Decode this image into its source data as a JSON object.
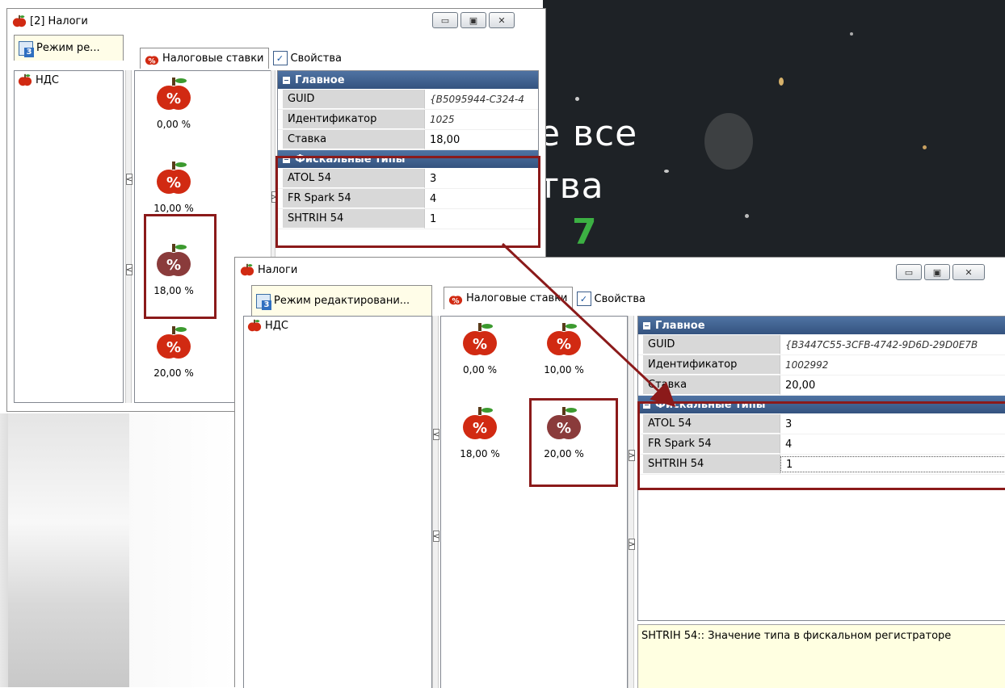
{
  "background": {
    "text_line1": "е все",
    "text_line2": "тва",
    "text_digit": "7"
  },
  "back_window": {
    "title": "[2] Налоги",
    "win_buttons": [
      "▭",
      "▣",
      "✕"
    ],
    "mode_tab_label": "Режим ре...",
    "mode_tab_badge": "3",
    "tab_rates_label": "Налоговые ставки",
    "tab_props_label": "Свойства",
    "tree_items": [
      "НДС"
    ],
    "rates": [
      "0,00 %",
      "10,00 %",
      "18,00 %",
      "20,00 %"
    ],
    "selected_rate": "18,00 %",
    "splitter_arrows": [
      "<",
      "<",
      ">"
    ],
    "props": {
      "main_header": "Главное",
      "main_rows": [
        {
          "key": "GUID",
          "value": "{B5095944-C324-4"
        },
        {
          "key": "Идентификатор",
          "value": "1025"
        },
        {
          "key": "Ставка",
          "value": "18,00"
        }
      ],
      "fiscal_header": "Фискальные типы",
      "fiscal_rows": [
        {
          "key": "ATOL 54",
          "value": "3"
        },
        {
          "key": "FR Spark 54",
          "value": "4"
        },
        {
          "key": "SHTRIH 54",
          "value": "1"
        }
      ]
    }
  },
  "front_window": {
    "title": "Налоги",
    "win_buttons": [
      "▭",
      "▣",
      "✕"
    ],
    "mode_tab_label": "Режим редактировани...",
    "mode_tab_badge": "3",
    "tab_rates_label": "Налоговые ставки",
    "tab_props_label": "Свойства",
    "tree_items": [
      "НДС"
    ],
    "rates": [
      "0,00 %",
      "10,00 %",
      "18,00 %",
      "20,00 %"
    ],
    "selected_rate": "20,00 %",
    "splitter_arrows": [
      "<",
      "<",
      ">",
      ">"
    ],
    "props": {
      "main_header": "Главное",
      "main_rows": [
        {
          "key": "GUID",
          "value": "{B3447C55-3CFB-4742-9D6D-29D0E7B"
        },
        {
          "key": "Идентификатор",
          "value": "1002992"
        },
        {
          "key": "Ставка",
          "value": "20,00"
        }
      ],
      "fiscal_header": "Фискальные типы",
      "fiscal_rows": [
        {
          "key": "ATOL 54",
          "value": "3"
        },
        {
          "key": "FR Spark 54",
          "value": "4"
        },
        {
          "key": "SHTRIH 54",
          "value": "1"
        }
      ]
    },
    "help_text": "SHTRIH 54:: Значение типа в фискальном регистраторе"
  },
  "colors": {
    "category_header": "#3d5f8e",
    "highlight_frame": "#8b1a1a",
    "help_background": "#ffffe1",
    "apple_red": "#d12a12",
    "apple_selected": "#8a3b3b"
  },
  "icons": [
    "apple-percent-icon",
    "mode-icon",
    "checkbox-icon",
    "minimize-icon",
    "maximize-icon",
    "close-icon",
    "collapse-icon"
  ]
}
